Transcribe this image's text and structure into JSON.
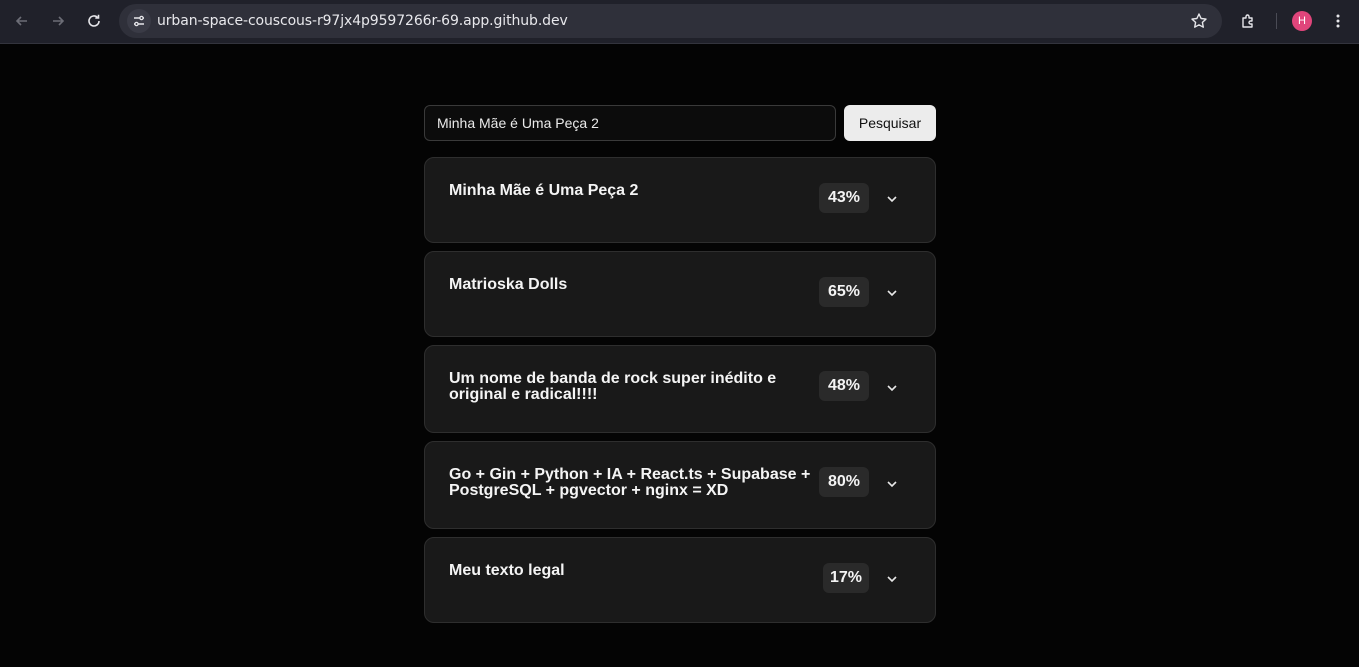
{
  "browser": {
    "url": "urban-space-couscous-r97jx4p9597266r-69.app.github.dev",
    "profile_initial": "H"
  },
  "search": {
    "value": "Minha Mãe é Uma Peça 2",
    "button_label": "Pesquisar"
  },
  "results": [
    {
      "title": "Minha Mãe é Uma Peça 2",
      "score": "43%"
    },
    {
      "title": "Matrioska Dolls",
      "score": "65%"
    },
    {
      "title": "Um nome de banda de rock super inédito e original e radical!!!!",
      "score": "48%"
    },
    {
      "title": "Go + Gin + Python + IA + React.ts + Supabase + PostgreSQL + pgvector + nginx = XD",
      "score": "80%"
    },
    {
      "title": "Meu texto legal",
      "score": "17%"
    }
  ]
}
